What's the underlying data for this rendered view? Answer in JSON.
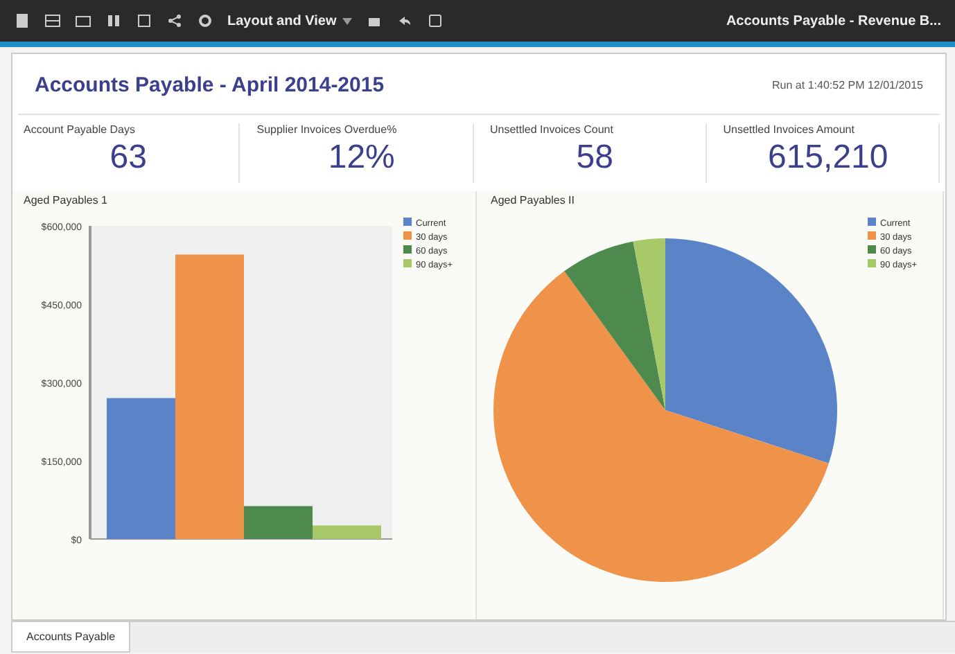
{
  "toolbar": {
    "layout_menu": "Layout and View",
    "report_menu": "Accounts Payable - Revenue B..."
  },
  "title": "Accounts Payable - April 2014-2015",
  "run_at": "Run at 1:40:52 PM 12/01/2015",
  "kpis": [
    {
      "label": "Account Payable Days",
      "value": "63"
    },
    {
      "label": "Supplier Invoices Overdue%",
      "value": "12%"
    },
    {
      "label": "Unsettled Invoices Count",
      "value": "58"
    },
    {
      "label": "Unsettled Invoices Amount",
      "value": "615,210"
    }
  ],
  "bar_panel": {
    "title": "Aged Payables 1",
    "chart_data": {
      "type": "bar",
      "legend": "right",
      "series": [
        {
          "name": "Current",
          "color": "#5b84c8",
          "values": [
            270000
          ]
        },
        {
          "name": "30 days",
          "color": "#f0934a",
          "values": [
            545000
          ]
        },
        {
          "name": "60 days",
          "color": "#4e8a4e",
          "values": [
            63000
          ]
        },
        {
          "name": "90 days+",
          "color": "#a8c96a",
          "values": [
            26000
          ]
        }
      ],
      "ylim": [
        0,
        600000
      ],
      "yticks": [
        {
          "value": 0,
          "label": "$0"
        },
        {
          "value": 150000,
          "label": "$150,000"
        },
        {
          "value": 300000,
          "label": "$300,000"
        },
        {
          "value": 450000,
          "label": "$450,000"
        },
        {
          "value": 600000,
          "label": "$600,000"
        }
      ]
    }
  },
  "pie_panel": {
    "title": "Aged Payables II",
    "chart_data": {
      "type": "pie",
      "legend": "right",
      "categories": [
        "Current",
        "30 days",
        "60 days",
        "90 days+"
      ],
      "series": [
        {
          "values": [
            30,
            60,
            7,
            3
          ]
        }
      ],
      "colors": [
        "#5b84c8",
        "#f0934a",
        "#4e8a4e",
        "#a8c96a"
      ]
    }
  },
  "sheet_tabs": [
    {
      "label": "Accounts Payable",
      "selected": true
    }
  ]
}
